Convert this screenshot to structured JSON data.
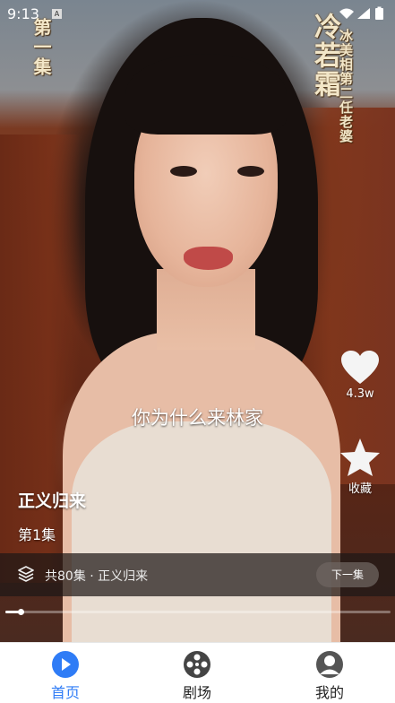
{
  "status_bar": {
    "time": "9:13",
    "badge": "A"
  },
  "video": {
    "episode_overlay": "第一集",
    "drama_name_overlay": "冷若霜",
    "drama_subtitle_overlay": "冰美相第二任老婆",
    "caption": "你为什么来林家"
  },
  "actions": {
    "like_count": "4.3w",
    "collect_label": "收藏"
  },
  "drama": {
    "title": "正义归来",
    "episode": "第1集"
  },
  "series_bar": {
    "info": "共80集 · 正义归来",
    "next_label": "下一集"
  },
  "playback": {
    "progress": 0.04
  },
  "nav": {
    "accent": "#2f7cf6",
    "items": [
      {
        "label": "首页",
        "icon": "play-icon",
        "active": true
      },
      {
        "label": "剧场",
        "icon": "film-reel-icon",
        "active": false
      },
      {
        "label": "我的",
        "icon": "person-icon",
        "active": false
      }
    ]
  }
}
